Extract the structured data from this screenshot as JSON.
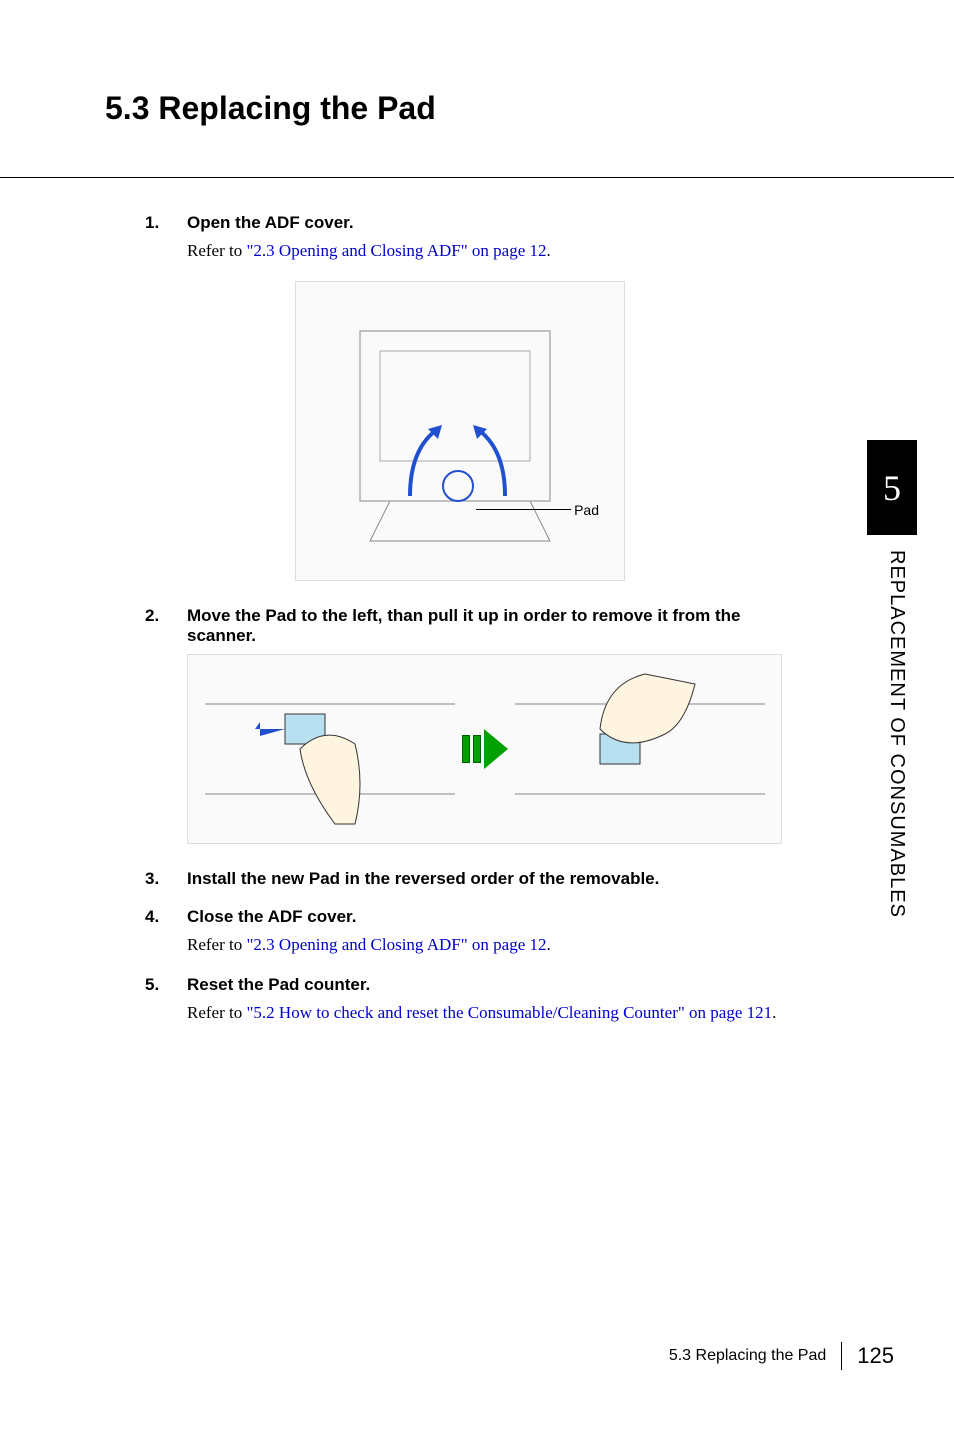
{
  "title": "5.3  Replacing the Pad",
  "chapter_number": "5",
  "chapter_side_label": "REPLACEMENT OF CONSUMABLES",
  "steps": [
    {
      "num": "1.",
      "title": "Open the ADF cover.",
      "body_prefix": "Refer to ",
      "body_link": "\"2.3 Opening and Closing ADF\" on page 12",
      "body_suffix": "."
    },
    {
      "num": "2.",
      "title": "Move the Pad to the left, than pull it up in order to remove it from the scanner."
    },
    {
      "num": "3.",
      "title": "Install the new Pad in the reversed order of the removable."
    },
    {
      "num": "4.",
      "title": "Close the ADF cover.",
      "body_prefix": "Refer to ",
      "body_link": "\"2.3 Opening and Closing ADF\" on page 12",
      "body_suffix": "."
    },
    {
      "num": "5.",
      "title": "Reset the Pad counter.",
      "body_prefix": "Refer to ",
      "body_link": "\"5.2 How to check and reset the Consumable/Cleaning Counter\" on page 121",
      "body_suffix": "."
    }
  ],
  "figure1_label": "Pad",
  "footer_section": "5.3 Replacing the Pad",
  "footer_page": "125"
}
